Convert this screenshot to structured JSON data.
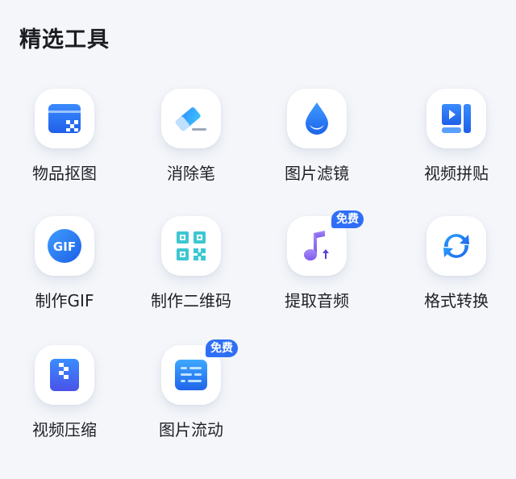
{
  "section": {
    "title": "精选工具"
  },
  "tools": [
    {
      "label": "物品抠图",
      "icon": "object-cutout-icon"
    },
    {
      "label": "消除笔",
      "icon": "eraser-icon"
    },
    {
      "label": "图片滤镜",
      "icon": "filter-drop-icon"
    },
    {
      "label": "视频拼贴",
      "icon": "video-collage-icon"
    },
    {
      "label": "制作GIF",
      "icon": "gif-icon",
      "icon_text": "GIF"
    },
    {
      "label": "制作二维码",
      "icon": "qr-code-icon"
    },
    {
      "label": "提取音频",
      "icon": "music-note-upload-icon",
      "badge": "免费"
    },
    {
      "label": "格式转换",
      "icon": "convert-arrows-icon"
    },
    {
      "label": "视频压缩",
      "icon": "video-compress-icon"
    },
    {
      "label": "图片流动",
      "icon": "image-flow-icon",
      "badge": "免费"
    }
  ],
  "colors": {
    "background": "#f4f6fa",
    "primary_blue": "#2e6ff5",
    "badge": "#2e6ff5",
    "teal": "#3cc7d2",
    "purple": "#8d6cf0"
  }
}
